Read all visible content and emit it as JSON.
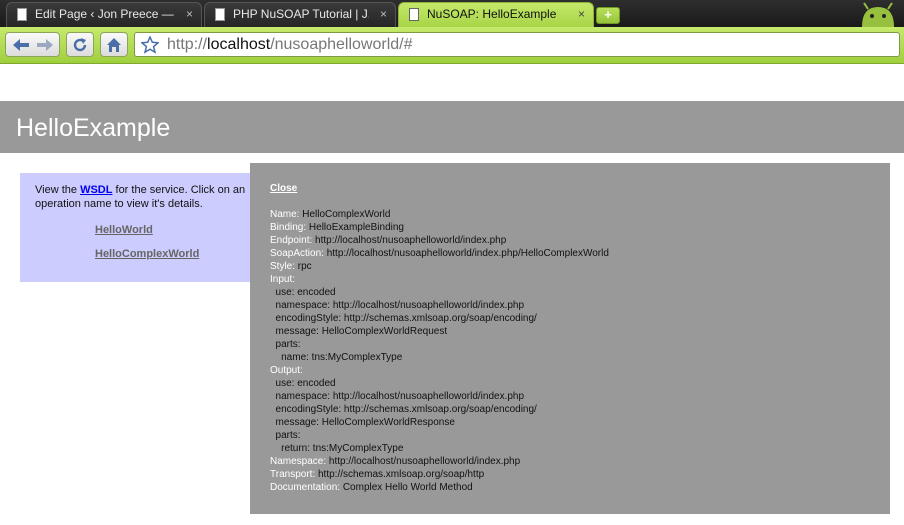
{
  "browser": {
    "tabs": [
      {
        "title": "Edit Page ‹ Jon Preece — ...",
        "active": false
      },
      {
        "title": "PHP NuSOAP Tutorial | J...",
        "active": false
      },
      {
        "title": "NuSOAP: HelloExample",
        "active": true
      }
    ],
    "new_tab_label": "+",
    "close_glyph": "×",
    "url_scheme": "http://",
    "url_host": "localhost",
    "url_path": "/nusoaphelloworld/#",
    "icons": [
      "back-arrow-icon",
      "forward-arrow-icon",
      "reload-icon",
      "home-icon",
      "bookmark-star-icon",
      "page-icon",
      "android-icon"
    ],
    "colors": {
      "toolbar": "#b3de55",
      "tabstrip": "#222222"
    }
  },
  "page": {
    "title": "HelloExample",
    "intro_before": "View the ",
    "wsdl_link": "WSDL",
    "intro_after": " for the service. Click on an operation name to view it's details.",
    "operations": [
      "HelloWorld",
      "HelloComplexWorld"
    ]
  },
  "popup": {
    "close_label": "Close",
    "rows": [
      {
        "key": "Name:",
        "value": " HelloComplexWorld"
      },
      {
        "key": "Binding:",
        "value": " HelloExampleBinding"
      },
      {
        "key": "Endpoint:",
        "value": " http://localhost/nusoaphelloworld/index.php"
      },
      {
        "key": "SoapAction:",
        "value": " http://localhost/nusoaphelloworld/index.php/HelloComplexWorld"
      },
      {
        "key": "Style:",
        "value": " rpc"
      },
      {
        "key": "Input:",
        "value": ""
      },
      {
        "key": "",
        "value": "  use: encoded"
      },
      {
        "key": "",
        "value": "  namespace: http://localhost/nusoaphelloworld/index.php"
      },
      {
        "key": "",
        "value": "  encodingStyle: http://schemas.xmlsoap.org/soap/encoding/"
      },
      {
        "key": "",
        "value": "  message: HelloComplexWorldRequest"
      },
      {
        "key": "",
        "value": "  parts:"
      },
      {
        "key": "",
        "value": "    name: tns:MyComplexType"
      },
      {
        "key": "Output:",
        "value": ""
      },
      {
        "key": "",
        "value": "  use: encoded"
      },
      {
        "key": "",
        "value": "  namespace: http://localhost/nusoaphelloworld/index.php"
      },
      {
        "key": "",
        "value": "  encodingStyle: http://schemas.xmlsoap.org/soap/encoding/"
      },
      {
        "key": "",
        "value": "  message: HelloComplexWorldResponse"
      },
      {
        "key": "",
        "value": "  parts:"
      },
      {
        "key": "",
        "value": "    return: tns:MyComplexType"
      },
      {
        "key": "Namespace:",
        "value": " http://localhost/nusoaphelloworld/index.php"
      },
      {
        "key": "Transport:",
        "value": " http://schemas.xmlsoap.org/soap/http"
      },
      {
        "key": "Documentation:",
        "value": " Complex Hello World Method"
      }
    ]
  }
}
